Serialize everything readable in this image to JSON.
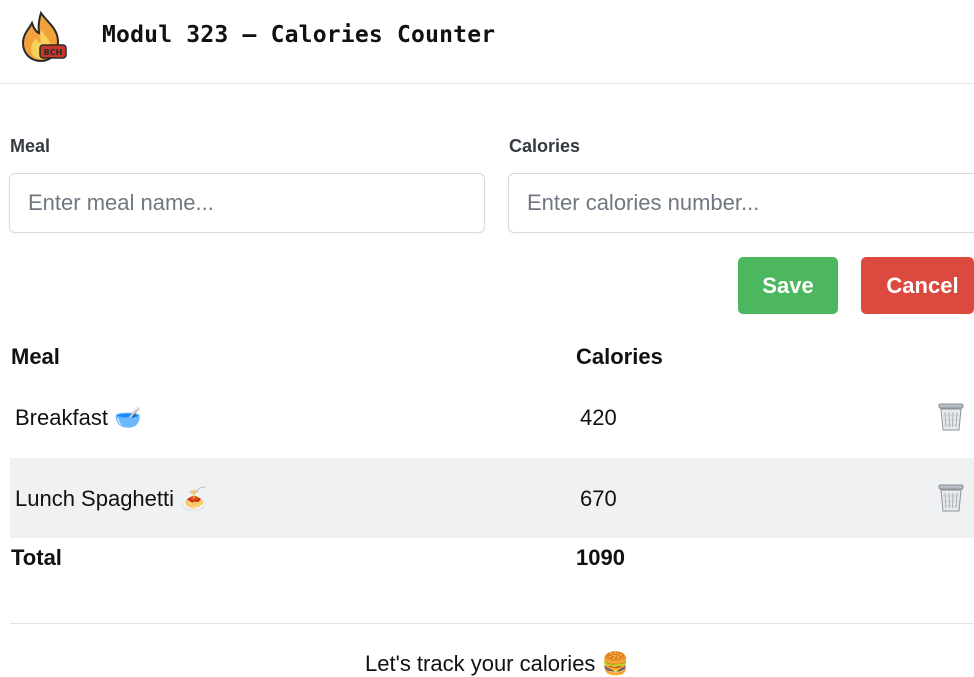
{
  "header": {
    "title": "Modul 323 – Calories Counter",
    "logo_badge": "BCH"
  },
  "form": {
    "meal_label": "Meal",
    "meal_placeholder": "Enter meal name...",
    "calories_label": "Calories",
    "calories_placeholder": "Enter calories number...",
    "save_label": "Save",
    "cancel_label": "Cancel"
  },
  "colors": {
    "save": "#4cb75f",
    "cancel": "#dc4a3f",
    "row_alt": "#f0f1f3"
  },
  "table": {
    "headers": {
      "meal": "Meal",
      "calories": "Calories"
    },
    "rows": [
      {
        "meal": "Breakfast",
        "emoji": "🥣",
        "calories": "420",
        "icon": "trash-icon"
      },
      {
        "meal": "Lunch Spaghetti",
        "emoji": "🍝",
        "calories": "670",
        "icon": "trash-icon"
      }
    ],
    "total_label": "Total",
    "total_value": "1090"
  },
  "footer": {
    "text": "Let's track your calories",
    "emoji": "🍔"
  }
}
